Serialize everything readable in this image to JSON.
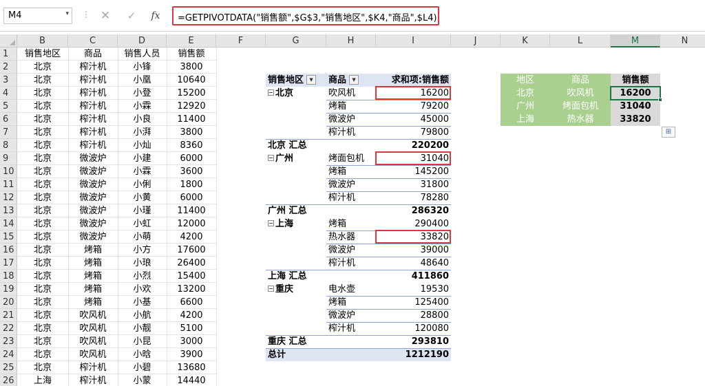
{
  "formula_bar": {
    "name_box": "M4",
    "name_box_arrow": "▾",
    "separator": "⋮",
    "cancel_glyph": "✕",
    "enter_glyph": "✓",
    "fx_label": "fx",
    "formula": "=GETPIVOTDATA(\"销售额\",$G$3,\"销售地区\",$K4,\"商品\",$L4)"
  },
  "columns": [
    "B",
    "C",
    "D",
    "E",
    "F",
    "G",
    "H",
    "I",
    "J",
    "K",
    "L",
    "M",
    "N"
  ],
  "rows": [
    "1",
    "2",
    "3",
    "4",
    "5",
    "6",
    "7",
    "8",
    "9",
    "10",
    "11",
    "12",
    "13",
    "14",
    "15",
    "16",
    "17",
    "18",
    "19",
    "20",
    "21",
    "22",
    "23",
    "24",
    "25",
    "26"
  ],
  "source_table": {
    "headers": [
      "销售地区",
      "商品",
      "销售人员",
      "销售额"
    ],
    "rows": [
      [
        "北京",
        "榨汁机",
        "小锋",
        "3800"
      ],
      [
        "北京",
        "榨汁机",
        "小凰",
        "10640"
      ],
      [
        "北京",
        "榨汁机",
        "小登",
        "15200"
      ],
      [
        "北京",
        "榨汁机",
        "小霖",
        "12920"
      ],
      [
        "北京",
        "榨汁机",
        "小良",
        "11400"
      ],
      [
        "北京",
        "榨汁机",
        "小湃",
        "3800"
      ],
      [
        "北京",
        "榨汁机",
        "小灿",
        "8360"
      ],
      [
        "北京",
        "微波炉",
        "小建",
        "6000"
      ],
      [
        "北京",
        "微波炉",
        "小霖",
        "3600"
      ],
      [
        "北京",
        "微波炉",
        "小俐",
        "1800"
      ],
      [
        "北京",
        "微波炉",
        "小黄",
        "6000"
      ],
      [
        "北京",
        "微波炉",
        "小瑾",
        "11400"
      ],
      [
        "北京",
        "微波炉",
        "小虹",
        "12000"
      ],
      [
        "北京",
        "微波炉",
        "小萌",
        "4200"
      ],
      [
        "北京",
        "烤箱",
        "小方",
        "17600"
      ],
      [
        "北京",
        "烤箱",
        "小琅",
        "26400"
      ],
      [
        "北京",
        "烤箱",
        "小烈",
        "15400"
      ],
      [
        "北京",
        "烤箱",
        "小欢",
        "13200"
      ],
      [
        "北京",
        "烤箱",
        "小基",
        "6600"
      ],
      [
        "北京",
        "吹风机",
        "小航",
        "4200"
      ],
      [
        "北京",
        "吹风机",
        "小靓",
        "5100"
      ],
      [
        "北京",
        "吹风机",
        "小昆",
        "3000"
      ],
      [
        "北京",
        "吹风机",
        "小晗",
        "3900"
      ],
      [
        "北京",
        "榨汁机",
        "小碧",
        "13680"
      ],
      [
        "上海",
        "榨汁机",
        "小蒙",
        "14440"
      ]
    ]
  },
  "pivot": {
    "header": {
      "region": "销售地区",
      "product": "商品",
      "value": "求和项:销售额",
      "filter_glyph": "▼",
      "collapse_glyph": "−"
    },
    "groups": [
      {
        "region": "北京",
        "items": [
          [
            "吹风机",
            "16200"
          ],
          [
            "烤箱",
            "79200"
          ],
          [
            "微波炉",
            "45000"
          ],
          [
            "榨汁机",
            "79800"
          ]
        ],
        "subtotal_label": "北京 汇总",
        "subtotal": "220200"
      },
      {
        "region": "广州",
        "items": [
          [
            "烤面包机",
            "31040"
          ],
          [
            "烤箱",
            "145200"
          ],
          [
            "微波炉",
            "31800"
          ],
          [
            "榨汁机",
            "78280"
          ]
        ],
        "subtotal_label": "广州 汇总",
        "subtotal": "286320"
      },
      {
        "region": "上海",
        "items": [
          [
            "烤箱",
            "290400"
          ],
          [
            "热水器",
            "33820"
          ],
          [
            "微波炉",
            "39000"
          ],
          [
            "榨汁机",
            "48640"
          ]
        ],
        "subtotal_label": "上海 汇总",
        "subtotal": "411860"
      },
      {
        "region": "重庆",
        "items": [
          [
            "电水壶",
            "19530"
          ],
          [
            "烤箱",
            "125400"
          ],
          [
            "微波炉",
            "28800"
          ],
          [
            "榨汁机",
            "120080"
          ]
        ],
        "subtotal_label": "重庆 汇总",
        "subtotal": "293810"
      }
    ],
    "grand_total_label": "总计",
    "grand_total": "1212190"
  },
  "lookup": {
    "headers": [
      "地区",
      "商品",
      "销售额"
    ],
    "rows": [
      [
        "北京",
        "吹风机",
        "16200"
      ],
      [
        "广州",
        "烤面包机",
        "31040"
      ],
      [
        "上海",
        "热水器",
        "33820"
      ]
    ]
  },
  "paste_options_icon": "⊞",
  "colors": {
    "accent_green": "#217346",
    "highlight_red": "#d9363e",
    "pivot_blue": "#dde4f2",
    "lookup_green": "#a9d08e",
    "lookup_grey": "#d9d9d9"
  }
}
